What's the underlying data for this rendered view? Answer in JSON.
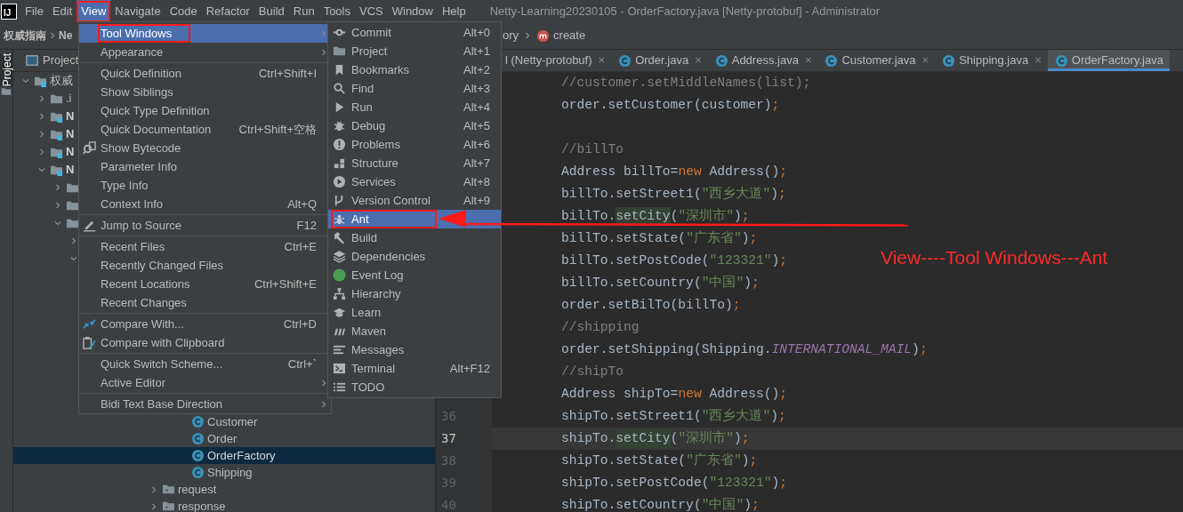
{
  "app_logo": {
    "text": "IJ"
  },
  "menu_bar": [
    {
      "label": "File",
      "selected": false,
      "boxed": false
    },
    {
      "label": "Edit",
      "selected": false,
      "boxed": false
    },
    {
      "label": "View",
      "selected": true,
      "boxed": true
    },
    {
      "label": "Navigate",
      "selected": false,
      "boxed": false
    },
    {
      "label": "Code",
      "selected": false,
      "boxed": false
    },
    {
      "label": "Refactor",
      "selected": false,
      "boxed": false
    },
    {
      "label": "Build",
      "selected": false,
      "boxed": false
    },
    {
      "label": "Run",
      "selected": false,
      "boxed": false
    },
    {
      "label": "Tools",
      "selected": false,
      "boxed": false
    },
    {
      "label": "VCS",
      "selected": false,
      "boxed": false
    },
    {
      "label": "Window",
      "selected": false,
      "boxed": false
    },
    {
      "label": "Help",
      "selected": false,
      "boxed": false
    }
  ],
  "window_title": "Netty-Learning20230105 - OrderFactory.java [Netty-protobuf] - Administrator",
  "breadcrumbs_left": [
    "权威指南",
    "Ne"
  ],
  "breadcrumbs_right": [
    {
      "label": "ory",
      "kind": "text"
    },
    {
      "label": "create",
      "kind": "method"
    }
  ],
  "tool_strip": {
    "label": "Project",
    "selected": true
  },
  "project_panel": {
    "title": "Project",
    "tree": [
      {
        "label": "权威",
        "kind": "module",
        "expanded": true,
        "children": [
          {
            "label": ".i",
            "kind": "folder",
            "expanded": false
          },
          {
            "label": "N",
            "kind": "module",
            "expanded": false
          },
          {
            "label": "N",
            "kind": "module",
            "expanded": false
          },
          {
            "label": "N",
            "kind": "module",
            "expanded": false
          },
          {
            "label": "N",
            "kind": "module",
            "expanded": true,
            "children": [
              {
                "kind": "folder",
                "expanded": false
              },
              {
                "kind": "folder",
                "expanded": false
              },
              {
                "kind": "folder",
                "expanded": true,
                "children": [
                  {
                    "expanded": false
                  },
                  {
                    "expanded": true
                  }
                ]
              }
            ]
          }
        ]
      }
    ],
    "lower_classes": [
      {
        "label": "Customer",
        "selected": false
      },
      {
        "label": "Order",
        "selected": false
      },
      {
        "label": "OrderFactory",
        "selected": true
      },
      {
        "label": "Shipping",
        "selected": false
      }
    ],
    "lower_packages": [
      {
        "label": "request",
        "expanded": false
      },
      {
        "label": "response",
        "expanded": false
      }
    ]
  },
  "editor": {
    "tabs": [
      {
        "label": "l (Netty-protobuf)",
        "kind": "partial",
        "close": "×",
        "selected": false
      },
      {
        "label": "Order.java",
        "kind": "class",
        "close": "×",
        "selected": false
      },
      {
        "label": "Address.java",
        "kind": "class",
        "close": "×",
        "selected": false
      },
      {
        "label": "Customer.java",
        "kind": "class",
        "close": "×",
        "selected": false
      },
      {
        "label": "Shipping.java",
        "kind": "class",
        "close": "×",
        "selected": false
      },
      {
        "label": "OrderFactory.java",
        "kind": "class",
        "selected": true
      }
    ],
    "lines": [
      {
        "current": false,
        "tokens": [
          {
            "kind": "comment",
            "text": "//customer.setMiddleNames(list);"
          }
        ]
      },
      {
        "current": false,
        "tokens": [
          {
            "kind": "plain",
            "text": "order.setCustomer(customer)"
          },
          {
            "kind": "punct",
            "text": ";"
          }
        ]
      },
      {
        "current": false
      },
      {
        "current": false,
        "tokens": [
          {
            "kind": "comment",
            "text": "//billTo"
          }
        ]
      },
      {
        "current": false,
        "tokens": [
          {
            "kind": "plain",
            "text": "Address billTo="
          },
          {
            "kind": "keyword",
            "text": "new"
          },
          {
            "kind": "plain",
            "text": " Address()"
          },
          {
            "kind": "punct",
            "text": ";"
          }
        ]
      },
      {
        "current": false,
        "tokens": [
          {
            "kind": "plain",
            "text": "billTo.setStreet1("
          },
          {
            "kind": "string",
            "text": "\"西乡大道\""
          },
          {
            "kind": "plain",
            "text": ")"
          },
          {
            "kind": "punct",
            "text": ";"
          }
        ]
      },
      {
        "current": false,
        "tokens": [
          {
            "kind": "plain",
            "text": "billTo."
          },
          {
            "kind": "usage",
            "text": "setCity"
          },
          {
            "kind": "plain",
            "text": "("
          },
          {
            "kind": "string",
            "text": "\"深圳市\""
          },
          {
            "kind": "plain",
            "text": ")"
          },
          {
            "kind": "punct",
            "text": ";"
          }
        ]
      },
      {
        "current": false,
        "tokens": [
          {
            "kind": "plain",
            "text": "billTo.setState("
          },
          {
            "kind": "string",
            "text": "\"广东省\""
          },
          {
            "kind": "plain",
            "text": ")"
          },
          {
            "kind": "punct",
            "text": ";"
          }
        ]
      },
      {
        "current": false,
        "tokens": [
          {
            "kind": "plain",
            "text": "billTo.setPostCode("
          },
          {
            "kind": "string",
            "text": "\"123321\""
          },
          {
            "kind": "plain",
            "text": ")"
          },
          {
            "kind": "punct",
            "text": ";"
          }
        ]
      },
      {
        "current": false,
        "tokens": [
          {
            "kind": "plain",
            "text": "billTo.setCountry("
          },
          {
            "kind": "string",
            "text": "\"中国\""
          },
          {
            "kind": "plain",
            "text": ")"
          },
          {
            "kind": "punct",
            "text": ";"
          }
        ]
      },
      {
        "current": false,
        "tokens": [
          {
            "kind": "plain",
            "text": "order.setBilTo(billTo)"
          },
          {
            "kind": "punct",
            "text": ";"
          }
        ]
      },
      {
        "current": false,
        "tokens": [
          {
            "kind": "comment",
            "text": "//shipping"
          }
        ]
      },
      {
        "current": false,
        "tokens": [
          {
            "kind": "plain",
            "text": "order.setShipping(Shipping."
          },
          {
            "kind": "constant",
            "text": "INTERNATIONAL_MAIL"
          },
          {
            "kind": "plain",
            "text": ")"
          },
          {
            "kind": "punct",
            "text": ";"
          }
        ]
      },
      {
        "current": false,
        "tokens": [
          {
            "kind": "comment",
            "text": "//shipTo"
          }
        ]
      },
      {
        "current": false,
        "tokens": [
          {
            "kind": "plain",
            "text": "Address shipTo="
          },
          {
            "kind": "keyword",
            "text": "new"
          },
          {
            "kind": "plain",
            "text": " Address()"
          },
          {
            "kind": "punct",
            "text": ";"
          }
        ]
      },
      {
        "number": "36",
        "current": false,
        "tokens": [
          {
            "kind": "plain",
            "text": "shipTo.setStreet1("
          },
          {
            "kind": "string",
            "text": "\"西乡大道\""
          },
          {
            "kind": "plain",
            "text": ")"
          },
          {
            "kind": "punct",
            "text": ";"
          }
        ]
      },
      {
        "number": "37",
        "current": true,
        "tokens": [
          {
            "kind": "plain",
            "text": "shipTo."
          },
          {
            "kind": "usage",
            "text": "setCity"
          },
          {
            "kind": "plain",
            "text": "("
          },
          {
            "kind": "string",
            "text": "\"深圳市\""
          },
          {
            "kind": "plain",
            "text": ")"
          },
          {
            "kind": "punct",
            "text": ";"
          }
        ]
      },
      {
        "number": "38",
        "current": false,
        "tokens": [
          {
            "kind": "plain",
            "text": "shipTo.setState("
          },
          {
            "kind": "string",
            "text": "\"广东省\""
          },
          {
            "kind": "plain",
            "text": ")"
          },
          {
            "kind": "punct",
            "text": ";"
          }
        ]
      },
      {
        "number": "39",
        "current": false,
        "tokens": [
          {
            "kind": "plain",
            "text": "shipTo.setPostCode("
          },
          {
            "kind": "string",
            "text": "\"123321\""
          },
          {
            "kind": "plain",
            "text": ")"
          },
          {
            "kind": "punct",
            "text": ";"
          }
        ]
      },
      {
        "number": "40",
        "current": false,
        "tokens": [
          {
            "kind": "plain",
            "text": "shipTo.setCountry("
          },
          {
            "kind": "string",
            "text": "\"中国\""
          },
          {
            "kind": "plain",
            "text": ")"
          },
          {
            "kind": "punct",
            "text": ";"
          }
        ]
      }
    ]
  },
  "view_menu": {
    "groups": [
      [
        {
          "label": "Tool Windows",
          "submenu": true,
          "selected": true,
          "boxed": true
        },
        {
          "label": "Appearance",
          "submenu": true,
          "selected": false,
          "boxed": false
        }
      ],
      [
        {
          "label": "Quick Definition",
          "shortcut": "Ctrl+Shift+I",
          "submenu": false,
          "selected": false,
          "boxed": false
        },
        {
          "label": "Show Siblings",
          "submenu": false,
          "selected": false,
          "boxed": false
        },
        {
          "label": "Quick Type Definition",
          "submenu": false,
          "selected": false,
          "boxed": false
        },
        {
          "label": "Quick Documentation",
          "shortcut": "Ctrl+Shift+空格",
          "submenu": false,
          "selected": false,
          "boxed": false
        },
        {
          "label": "Show Bytecode",
          "kind": "bytecode",
          "submenu": false,
          "selected": false,
          "boxed": false
        },
        {
          "label": "Parameter Info",
          "submenu": false,
          "selected": false,
          "boxed": false
        },
        {
          "label": "Type Info",
          "submenu": false,
          "selected": false,
          "boxed": false
        },
        {
          "label": "Context Info",
          "shortcut": "Alt+Q",
          "submenu": false,
          "selected": false,
          "boxed": false
        }
      ],
      [
        {
          "label": "Jump to Source",
          "shortcut": "F12",
          "kind": "edit",
          "submenu": false,
          "selected": false,
          "boxed": false
        }
      ],
      [
        {
          "label": "Recent Files",
          "shortcut": "Ctrl+E",
          "submenu": false,
          "selected": false,
          "boxed": false
        },
        {
          "label": "Recently Changed Files",
          "submenu": false,
          "selected": false,
          "boxed": false
        },
        {
          "label": "Recent Locations",
          "shortcut": "Ctrl+Shift+E",
          "submenu": false,
          "selected": false,
          "boxed": false
        },
        {
          "label": "Recent Changes",
          "submenu": false,
          "selected": false,
          "boxed": false
        }
      ],
      [
        {
          "label": "Compare With...",
          "shortcut": "Ctrl+D",
          "kind": "compare",
          "submenu": false,
          "selected": false,
          "boxed": false
        },
        {
          "label": "Compare with Clipboard",
          "kind": "clipboard",
          "submenu": false,
          "selected": false,
          "boxed": false
        }
      ],
      [
        {
          "label": "Quick Switch Scheme...",
          "shortcut": "Ctrl+`",
          "submenu": false,
          "selected": false,
          "boxed": false
        },
        {
          "label": "Active Editor",
          "submenu": true,
          "selected": false,
          "boxed": false
        }
      ],
      [
        {
          "label": "Bidi Text Base Direction",
          "submenu": true,
          "selected": false,
          "boxed": false
        }
      ]
    ]
  },
  "tool_windows_menu": {
    "items": [
      {
        "label": "Commit",
        "kind": "commit",
        "shortcut": "Alt+0",
        "selected": false,
        "boxed": false
      },
      {
        "label": "Project",
        "kind": "folder",
        "shortcut": "Alt+1",
        "selected": false,
        "boxed": false
      },
      {
        "label": "Bookmarks",
        "kind": "bookmark",
        "shortcut": "Alt+2",
        "selected": false,
        "boxed": false
      },
      {
        "label": "Find",
        "kind": "find",
        "shortcut": "Alt+3",
        "selected": false,
        "boxed": false
      },
      {
        "label": "Run",
        "kind": "run",
        "shortcut": "Alt+4",
        "selected": false,
        "boxed": false
      },
      {
        "label": "Debug",
        "kind": "debug",
        "shortcut": "Alt+5",
        "selected": false,
        "boxed": false
      },
      {
        "label": "Problems",
        "kind": "problems",
        "shortcut": "Alt+6",
        "selected": false,
        "boxed": false
      },
      {
        "label": "Structure",
        "kind": "structure",
        "shortcut": "Alt+7",
        "selected": false,
        "boxed": false
      },
      {
        "label": "Services",
        "kind": "services",
        "shortcut": "Alt+8",
        "selected": false,
        "boxed": false
      },
      {
        "label": "Version Control",
        "kind": "vcs",
        "shortcut": "Alt+9",
        "selected": false,
        "boxed": false
      },
      {
        "label": "Ant",
        "kind": "ant",
        "selected": true,
        "boxed": true
      },
      {
        "label": "Build",
        "kind": "build",
        "selected": false,
        "boxed": false
      },
      {
        "label": "Dependencies",
        "kind": "dependencies",
        "selected": false,
        "boxed": false
      },
      {
        "label": "Event Log",
        "kind": "eventlog",
        "selected": false,
        "boxed": false
      },
      {
        "label": "Hierarchy",
        "kind": "hierarchy",
        "selected": false,
        "boxed": false
      },
      {
        "label": "Learn",
        "kind": "learn",
        "selected": false,
        "boxed": false
      },
      {
        "label": "Maven",
        "kind": "maven",
        "selected": false,
        "boxed": false
      },
      {
        "label": "Messages",
        "kind": "messages",
        "selected": false,
        "boxed": false
      },
      {
        "label": "Terminal",
        "kind": "terminal",
        "shortcut": "Alt+F12",
        "selected": false,
        "boxed": false
      },
      {
        "label": "TODO",
        "kind": "todo",
        "selected": false,
        "boxed": false
      }
    ]
  },
  "annotation": {
    "label": "View----Tool Windows---Ant"
  }
}
